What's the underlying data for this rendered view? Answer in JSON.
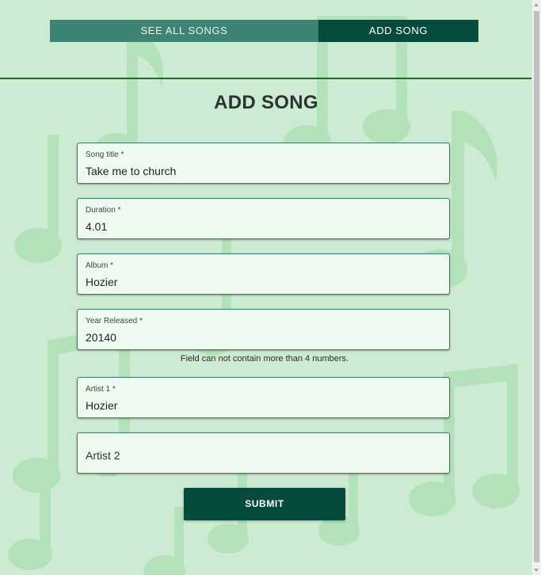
{
  "nav": {
    "tabs": [
      {
        "label": "SEE ALL SONGS",
        "active": false
      },
      {
        "label": "ADD SONG",
        "active": true
      }
    ]
  },
  "page_title": "ADD SONG",
  "form": {
    "song_title": {
      "label": "Song title *",
      "value": "Take me to church"
    },
    "duration": {
      "label": "Duration *",
      "value": "4.01"
    },
    "album": {
      "label": "Album *",
      "value": "Hozier"
    },
    "year_released": {
      "label": "Year Released *",
      "value": "20140",
      "error": "Field can not contain more than 4 numbers."
    },
    "artist_1": {
      "label": "Artist 1 *",
      "value": "Hozier"
    },
    "artist_2": {
      "placeholder": "Artist 2",
      "value": ""
    },
    "submit_label": "SUBMIT"
  },
  "colors": {
    "background": "#cdebd2",
    "notes": "#9fdaa8",
    "primary_dark": "#074a3e",
    "primary_light": "#3f8276",
    "divider": "#1a6b25",
    "field_bg": "#eef9f0"
  },
  "icons": {
    "background": "music-note-icon"
  }
}
